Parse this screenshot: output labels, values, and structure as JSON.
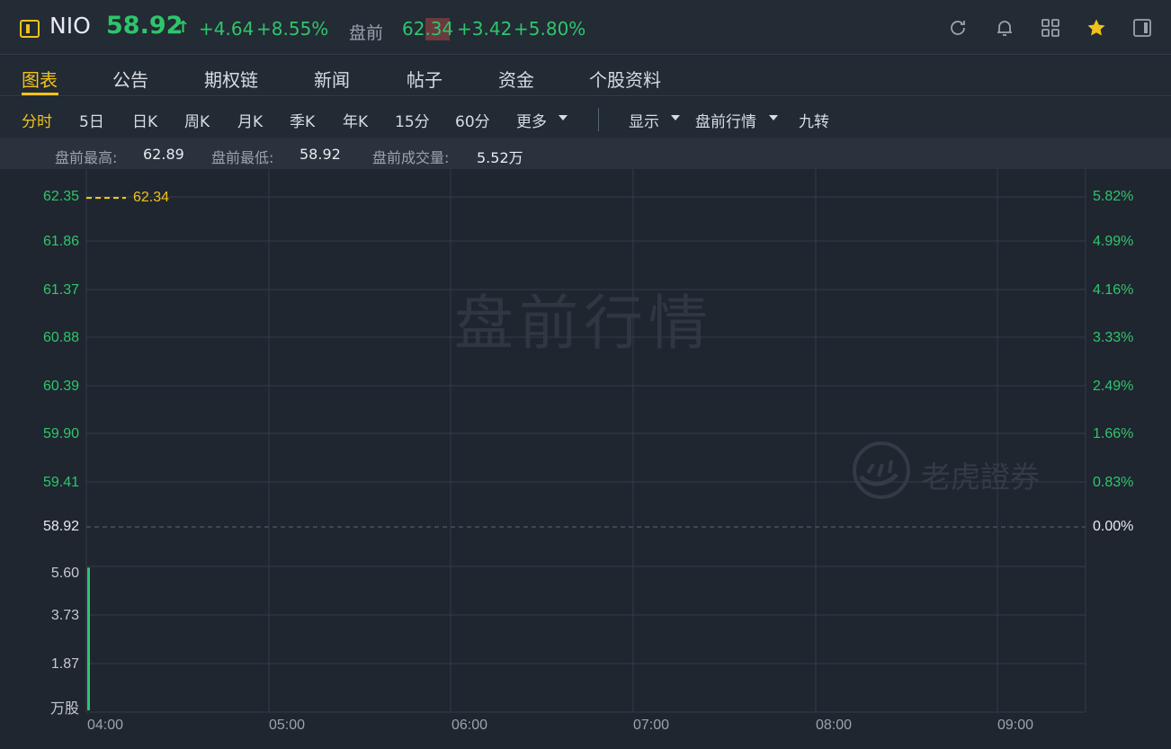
{
  "header": {
    "symbol": "NIO",
    "price": "58.92",
    "arrow": "↑",
    "change": "+4.64",
    "change_pct": "+8.55%",
    "premarket_label": "盘前",
    "premarket_price": "62.34",
    "premarket_change": "+3.42",
    "premarket_change_pct": "+5.80%",
    "icons": [
      "refresh-icon",
      "bell-icon",
      "grid-icon",
      "star-icon",
      "panel-icon"
    ]
  },
  "tabs": {
    "items": [
      "图表",
      "公告",
      "期权链",
      "新闻",
      "帖子",
      "资金",
      "个股资料"
    ],
    "active": "图表"
  },
  "periods": {
    "items": [
      "分时",
      "5日",
      "日K",
      "周K",
      "月K",
      "季K",
      "年K",
      "15分",
      "60分",
      "更多"
    ],
    "active": "分时",
    "display": "显示",
    "premarket": "盘前行情",
    "nine_turn": "九转"
  },
  "stats": {
    "high_label": "盘前最高:",
    "high": "62.89",
    "low_label": "盘前最低:",
    "low": "58.92",
    "volume_label": "盘前成交量:",
    "volume": "5.52万"
  },
  "chart": {
    "price_ticks": [
      "62.35",
      "61.86",
      "61.37",
      "60.88",
      "60.39",
      "59.90",
      "59.41",
      "58.92"
    ],
    "pct_ticks": [
      "5.82%",
      "4.99%",
      "4.16%",
      "3.33%",
      "2.49%",
      "1.66%",
      "0.83%",
      "0.00%"
    ],
    "volume_ticks": [
      "5.60",
      "3.73",
      "1.87",
      "万股"
    ],
    "time_ticks": [
      "04:00",
      "05:00",
      "06:00",
      "07:00",
      "08:00",
      "09:00"
    ],
    "current_line_label": "62.34",
    "watermark": "盘前行情",
    "logo_text": "老虎證券"
  },
  "chart_data": {
    "type": "line",
    "x": [
      "04:00"
    ],
    "y_price": [
      62.34
    ],
    "y_volume_wan": [
      5.52
    ],
    "reference_price": 58.92,
    "ylim_price": [
      58.92,
      62.35
    ],
    "ylim_pct": [
      0.0,
      5.82
    ],
    "ylim_volume": [
      0,
      5.6
    ],
    "grid": true,
    "colors": {
      "up": "#2fc56b",
      "price_line": "#f1c21b",
      "accent": "#f1c21b",
      "background": "#1f2630"
    }
  }
}
